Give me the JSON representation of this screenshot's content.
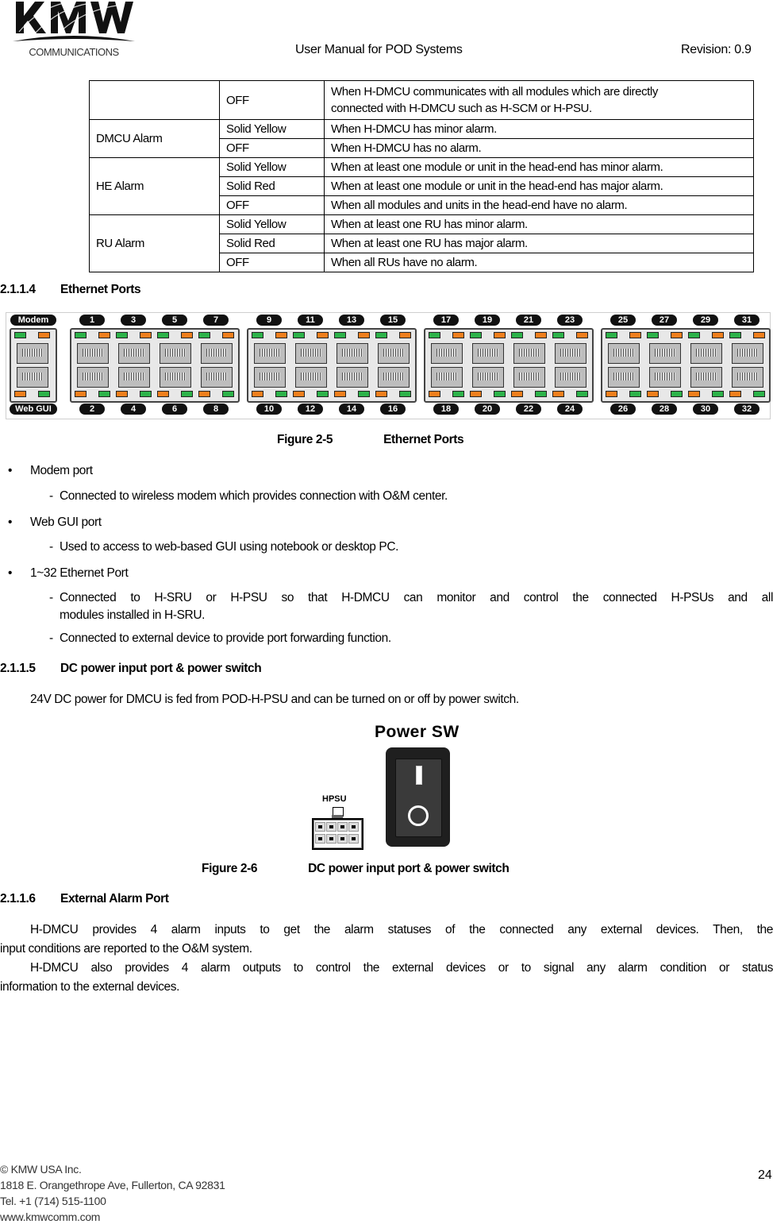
{
  "header": {
    "logo_text": "KMW",
    "logo_subtext": "COMMUNICATIONS",
    "title": "User Manual for POD Systems",
    "revision": "Revision: 0.9"
  },
  "led_table": {
    "rows": [
      {
        "group": "",
        "state": "OFF",
        "description_lines": [
          "When H-DMCU communicates with all modules which are directly",
          "connected with H-DMCU such as H-SCM or H-PSU."
        ]
      },
      {
        "group": "DMCU Alarm",
        "state": "Solid Yellow",
        "description": "When H-DMCU has minor alarm."
      },
      {
        "group": "",
        "state": "OFF",
        "description": "When H-DMCU has no alarm."
      },
      {
        "group": "HE Alarm",
        "state": "Solid Yellow",
        "description": "When at least one module or unit in the head-end has minor alarm."
      },
      {
        "group": "",
        "state": "Solid Red",
        "description": "When at least one module or unit in the head-end has major alarm."
      },
      {
        "group": "",
        "state": "OFF",
        "description": "When all modules and units in the head-end have no alarm."
      },
      {
        "group": "RU Alarm",
        "state": "Solid Yellow",
        "description": "When at least one RU has minor alarm."
      },
      {
        "group": "",
        "state": "Solid Red",
        "description": "When at least one RU has major alarm."
      },
      {
        "group": "",
        "state": "OFF",
        "description": "When all RUs have no alarm."
      }
    ]
  },
  "section_ethernet": {
    "number": "2.1.1.4",
    "title": "Ethernet Ports",
    "figure": {
      "top_labels": [
        "Modem",
        "1",
        "3",
        "5",
        "7",
        "9",
        "11",
        "13",
        "15",
        "17",
        "19",
        "21",
        "23",
        "25",
        "27",
        "29",
        "31"
      ],
      "bottom_labels": [
        "Web GUI",
        "2",
        "4",
        "6",
        "8",
        "10",
        "12",
        "14",
        "16",
        "18",
        "20",
        "22",
        "24",
        "26",
        "28",
        "30",
        "32"
      ],
      "led_colors": {
        "green": "#2db34a",
        "orange": "#f07f1d"
      }
    },
    "caption_number": "Figure 2-5",
    "caption_title": "Ethernet Ports",
    "bullets": [
      {
        "label": "Modem port",
        "sub": [
          "Connected to wireless modem which provides connection with O&M center."
        ]
      },
      {
        "label": "Web GUI port",
        "sub": [
          "Used to access to web-based GUI using notebook or desktop PC."
        ]
      },
      {
        "label": "1~32 Ethernet Port",
        "sub": [
          "Connected to H-SRU or H-PSU so that H-DMCU can monitor and control the connected H-PSUs and all",
          "modules installed in H-SRU.",
          "Connected to external device to provide port forwarding function."
        ]
      }
    ]
  },
  "section_power": {
    "number": "2.1.1.5",
    "title": "DC power input port & power switch",
    "body": "24V DC power for DMCU is fed from POD-H-PSU and can be turned on or off by power switch.",
    "figure": {
      "switch_label": "Power SW",
      "connector_label": "HPSU",
      "on_symbol": "I",
      "off_symbol": "O"
    },
    "caption_number": "Figure 2-6",
    "caption_title": "DC power input port & power switch"
  },
  "section_alarm": {
    "number": "2.1.1.6",
    "title": "External Alarm Port",
    "para1_line1": "H-DMCU provides 4 alarm inputs to get the alarm statuses of the connected any external devices. Then, the",
    "para1_line2": "input conditions are reported to the O&M system.",
    "para2_line1": "H-DMCU also provides 4 alarm outputs to control the external devices or to signal any alarm condition or status",
    "para2_line2": "information to the external devices."
  },
  "footer": {
    "copyright": "© KMW USA Inc.",
    "address": "1818 E. Orangethrope Ave, Fullerton, CA 92831",
    "phone": "Tel. +1 (714) 515-1100",
    "website": "www.kmwcomm.com",
    "page_number": "24"
  }
}
